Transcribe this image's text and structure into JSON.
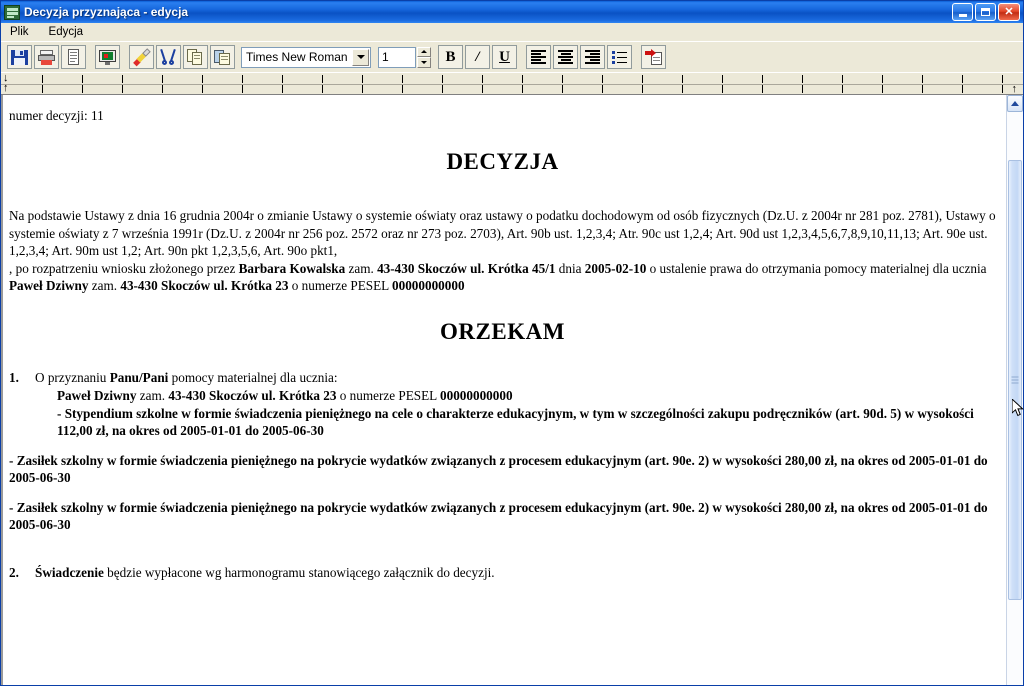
{
  "window": {
    "title": "Decyzja przyznająca - edycja",
    "icon": "document-editor-icon",
    "minimize_label": "_",
    "maximize_label": "❐",
    "close_label": "✕",
    "accent_color": "#0a52c4",
    "close_color": "#c22d14"
  },
  "menu": {
    "items": [
      {
        "label": "Plik"
      },
      {
        "label": "Edycja"
      }
    ]
  },
  "toolbar": {
    "buttons": [
      {
        "name": "save-button",
        "icon": "save-icon",
        "tooltip": "Zapisz"
      },
      {
        "name": "print-button",
        "icon": "print-icon",
        "tooltip": "Drukuj"
      },
      {
        "name": "page-setup-button",
        "icon": "document-icon",
        "tooltip": "Dokument"
      },
      {
        "name": "print-preview-button",
        "icon": "monitor-preview-icon",
        "tooltip": "Podgląd"
      },
      {
        "name": "format-painter-button",
        "icon": "brush-icon",
        "tooltip": "Malarz formatów"
      },
      {
        "name": "cut-button",
        "icon": "scissors-icon",
        "tooltip": "Wytnij"
      },
      {
        "name": "copy-button",
        "icon": "copy-icon",
        "tooltip": "Kopiuj"
      },
      {
        "name": "paste-button",
        "icon": "paste-icon",
        "tooltip": "Wklej"
      },
      {
        "name": "bold-button",
        "icon": "bold-icon",
        "label": "B"
      },
      {
        "name": "italic-button",
        "icon": "italic-icon",
        "label": "/"
      },
      {
        "name": "underline-button",
        "icon": "underline-icon",
        "label": "U"
      },
      {
        "name": "align-left-button",
        "icon": "align-left-icon"
      },
      {
        "name": "align-center-button",
        "icon": "align-center-icon"
      },
      {
        "name": "align-justify-button",
        "icon": "align-justify-icon"
      },
      {
        "name": "bullet-list-button",
        "icon": "bullet-list-icon"
      },
      {
        "name": "export-button",
        "icon": "export-document-icon"
      }
    ],
    "font_family": {
      "value": "Times New Roman",
      "placeholder": "Times New Roman"
    },
    "font_size": {
      "value": "1",
      "placeholder": "1"
    }
  },
  "ruler": {
    "first_line_indent_marker": "↓",
    "left_indent_marker": "↑",
    "right_indent_marker": "↑"
  },
  "document": {
    "decision_number_line": "numer decyzji: 11",
    "heading_1": "DECYZJA",
    "heading_2": "ORZEKAM",
    "legal_basis": {
      "line1_a": "Na podstawie Ustawy z dnia 16 grudnia 2004r o zmianie Ustawy o systemie oświaty oraz ustawy o podatku dochodowym od osób fizycznych (Dz.U. z 2004r nr 281 poz. 2781), Ustawy o systemie oświaty z 7 września 1991r (Dz.U. z 2004r nr 256 poz. 2572 oraz nr 273 poz. 2703), Art. 90b ust. 1,2,3,4;  Atr. 90c ust 1,2,4; Art. 90d ust 1,2,3,4,5,6,7,8,9,10,11,13; Art. 90e ust. 1,2,3,4; Art. 90m ust 1,2; Art. 90n pkt 1,2,3,5,6, Art. 90o pkt1,"
    },
    "application": {
      "prefix": ", po rozpatrzeniu wniosku złożonego przez ",
      "applicant_name": "Barbara Kowalska",
      "mid1": " zam. ",
      "applicant_address": "43-430 Skoczów ul. Krótka 45/1",
      "mid2": " dnia ",
      "application_date": "2005-02-10",
      "mid3": " o ustalenie prawa do otrzymania pomocy materialnej dla  ucznia ",
      "student_name": "Paweł Dziwny",
      "mid4": " zam. ",
      "student_address": "43-430 Skoczów ul. Krótka 23",
      "mid5": " o numerze PESEL ",
      "student_pesel": "00000000000"
    },
    "items": [
      {
        "number": "1.",
        "line1_prefix": "O przyznaniu ",
        "line1_bold": "Panu/Pani",
        "line1_suffix": "  pomocy materialnej dla ucznia:",
        "line2_name": "Paweł Dziwny",
        "line2_mid1": " zam. ",
        "line2_address": "43-430 Skoczów ul. Krótka 23",
        "line2_mid2": " o numerze PESEL ",
        "line2_pesel": "00000000000",
        "benefit_1": "- Stypendium szkolne w formie świadczenia pieniężnego na cele o charakterze edukacyjnym, w tym w szczególności zakupu podręczników (art. 90d. 5) w wysokości 112,00 zł, na okres od 2005-01-01 do 2005-06-30",
        "benefit_2": "- Zasiłek szkolny w formie świadczenia pieniężnego na pokrycie wydatków związanych z procesem edukacyjnym (art. 90e. 2) w wysokości 280,00 zł, na okres od 2005-01-01 do 2005-06-30",
        "benefit_3": "- Zasiłek szkolny w formie świadczenia pieniężnego na pokrycie wydatków związanych z procesem edukacyjnym (art. 90e. 2) w wysokości 280,00 zł, na okres od 2005-01-01 do 2005-06-30"
      },
      {
        "number": "2.",
        "bold_lead": "Świadczenie",
        "text": " będzie wypłacone wg harmonogramu stanowiącego załącznik do decyzji."
      }
    ]
  },
  "scrollbar": {
    "up_arrow": "▲",
    "down_arrow": "▼",
    "orientation": "vertical"
  }
}
